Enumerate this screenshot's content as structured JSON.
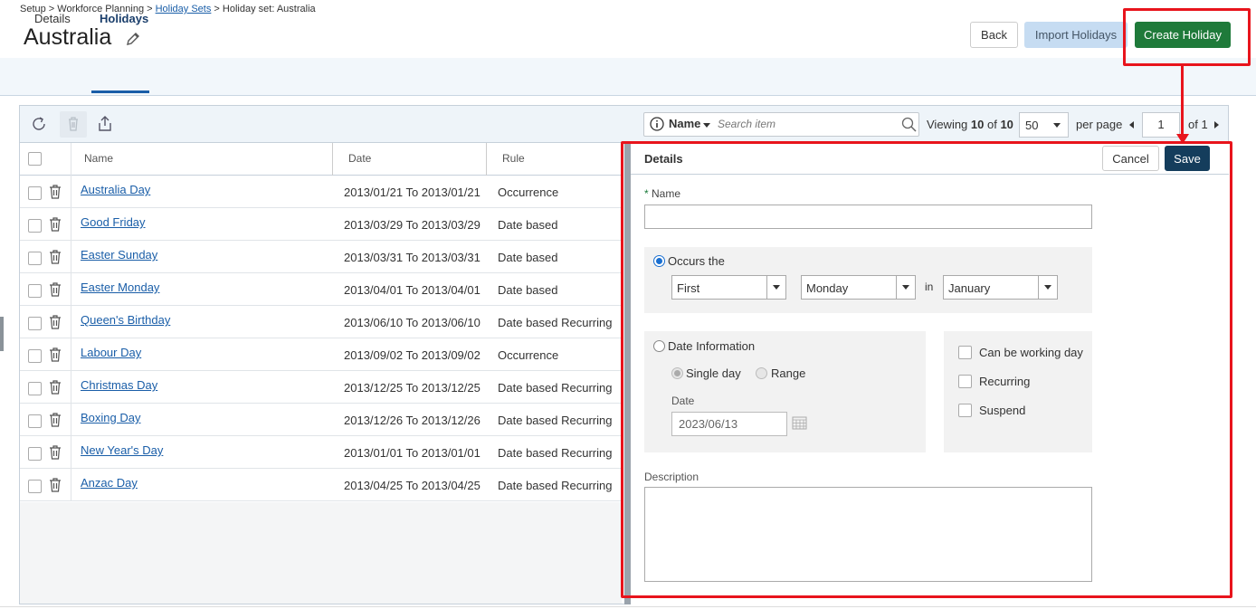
{
  "breadcrumb": {
    "part1": "Setup > Workforce Planning > ",
    "link": "Holiday Sets",
    "part2": " > Holiday set: Australia"
  },
  "page": {
    "title": "Australia"
  },
  "header_buttons": {
    "back": "Back",
    "import": "Import Holidays",
    "create": "Create Holiday"
  },
  "tabs": [
    {
      "label": "Details"
    },
    {
      "label": "Holidays"
    }
  ],
  "search": {
    "field": "Name",
    "placeholder": "Search item"
  },
  "pagination": {
    "viewing_prefix": "Viewing ",
    "viewing_count": "10",
    "viewing_of": " of ",
    "viewing_total": "10",
    "per_page_value": "50",
    "per_page_label": "per page",
    "page": "1",
    "of_pages": "of 1"
  },
  "table": {
    "columns": [
      "Name",
      "Date",
      "Rule"
    ],
    "rows": [
      {
        "name": "Australia Day",
        "date": "2013/01/21 To 2013/01/21",
        "rule": "Occurrence"
      },
      {
        "name": "Good Friday",
        "date": "2013/03/29 To 2013/03/29",
        "rule": "Date based"
      },
      {
        "name": "Easter Sunday",
        "date": "2013/03/31 To 2013/03/31",
        "rule": "Date based"
      },
      {
        "name": "Easter Monday",
        "date": "2013/04/01 To 2013/04/01",
        "rule": "Date based"
      },
      {
        "name": "Queen's Birthday",
        "date": "2013/06/10 To 2013/06/10",
        "rule": "Date based Recurring"
      },
      {
        "name": "Labour Day",
        "date": "2013/09/02 To 2013/09/02",
        "rule": "Occurrence"
      },
      {
        "name": "Christmas Day",
        "date": "2013/12/25 To 2013/12/25",
        "rule": "Date based Recurring"
      },
      {
        "name": "Boxing Day",
        "date": "2013/12/26 To 2013/12/26",
        "rule": "Date based Recurring"
      },
      {
        "name": "New Year's Day",
        "date": "2013/01/01 To 2013/01/01",
        "rule": "Date based Recurring"
      },
      {
        "name": "Anzac Day",
        "date": "2013/04/25 To 2013/04/25",
        "rule": "Date based Recurring"
      }
    ]
  },
  "details": {
    "title": "Details",
    "cancel": "Cancel",
    "save": "Save",
    "name_label": "Name",
    "name_value": "",
    "occurs_label": "Occurs the",
    "occurs_ordinal": "First",
    "occurs_weekday": "Monday",
    "occurs_in": "in",
    "occurs_month": "January",
    "date_info_label": "Date Information",
    "single_day": "Single day",
    "range": "Range",
    "date_label": "Date",
    "date_value": "2023/06/13",
    "can_be_working_day": "Can be working day",
    "recurring": "Recurring",
    "suspend": "Suspend",
    "description_label": "Description",
    "description_value": ""
  },
  "colors": {
    "highlight": "#e8141c",
    "create_button": "#1f7a3a",
    "save_button": "#143d5c",
    "link": "#1a5ea8"
  }
}
